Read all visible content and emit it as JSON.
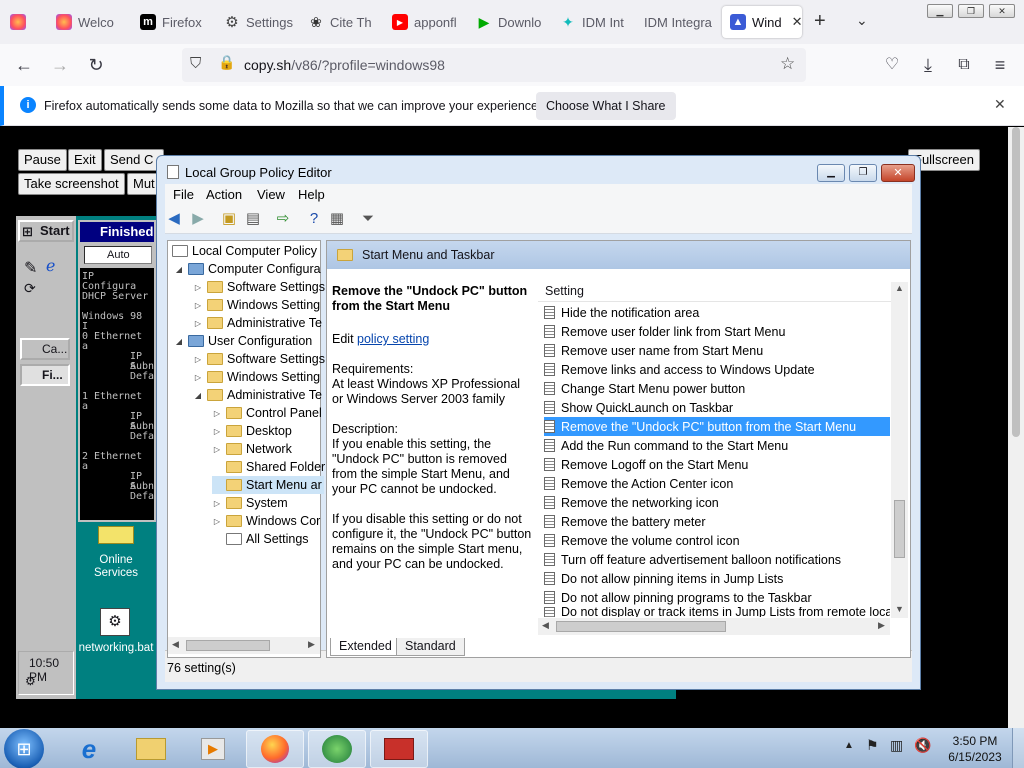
{
  "tabs": [
    {
      "label": "",
      "icon": "firefox-icon"
    },
    {
      "label": "Welco",
      "icon": "firefox-icon"
    },
    {
      "label": "Firefox I",
      "icon": "mdn-icon"
    },
    {
      "label": "Settings",
      "icon": "gear-icon"
    },
    {
      "label": "Cite Th",
      "icon": "cite-icon"
    },
    {
      "label": "apponfl",
      "icon": "youtube-icon"
    },
    {
      "label": "Downlo",
      "icon": "download-icon"
    },
    {
      "label": "IDM Int",
      "icon": "idm-icon"
    },
    {
      "label": "IDM Integrat",
      "icon": ""
    },
    {
      "label": "Wind",
      "icon": "v86-icon"
    }
  ],
  "url": {
    "host": "copy.sh",
    "path": "/v86/?profile=windows98"
  },
  "notification": {
    "text": "Firefox automatically sends some data to Mozilla so that we can improve your experience.",
    "button": "Choose What I Share"
  },
  "emulator": {
    "buttons": [
      "Pause",
      "Exit",
      "Send C",
      "Take screenshot",
      "Mut"
    ],
    "fullscreen": "Fullscreen"
  },
  "win98": {
    "start": "Start",
    "tasks": [
      "Ca...",
      "Fi..."
    ],
    "cmd_title": "Finished -",
    "cmd_dropdown": "Auto",
    "cmd_lines": [
      "IP Configura",
      "DHCP Server",
      "Windows 98 I",
      "0 Ethernet a",
      "IP A",
      "Subn",
      "Defa",
      "1 Ethernet a",
      "IP A",
      "Subn",
      "Defa",
      "2 Ethernet a",
      "IP A",
      "Subn",
      "Defa"
    ],
    "clock": "10:50 PM",
    "desktop_icons": [
      {
        "label": "Online Services"
      },
      {
        "label": "networking.bat"
      }
    ]
  },
  "gpe": {
    "title": "Local Group Policy Editor",
    "menu": [
      "File",
      "Action",
      "View",
      "Help"
    ],
    "tree": [
      {
        "label": "Local Computer Policy",
        "level": 0,
        "expander": ""
      },
      {
        "label": "Computer Configura",
        "level": 1,
        "expander": "down"
      },
      {
        "label": "Software Settings",
        "level": 2,
        "expander": "right"
      },
      {
        "label": "Windows Setting",
        "level": 2,
        "expander": "right"
      },
      {
        "label": "Administrative Te",
        "level": 2,
        "expander": "right"
      },
      {
        "label": "User Configuration",
        "level": 1,
        "expander": "down"
      },
      {
        "label": "Software Settings",
        "level": 2,
        "expander": "right"
      },
      {
        "label": "Windows Setting",
        "level": 2,
        "expander": "right"
      },
      {
        "label": "Administrative Te",
        "level": 2,
        "expander": "down"
      },
      {
        "label": "Control Panel",
        "level": 3,
        "expander": "right"
      },
      {
        "label": "Desktop",
        "level": 3,
        "expander": "right"
      },
      {
        "label": "Network",
        "level": 3,
        "expander": "right"
      },
      {
        "label": "Shared Folder",
        "level": 3,
        "expander": ""
      },
      {
        "label": "Start Menu ar",
        "level": 3,
        "expander": "",
        "selected": true
      },
      {
        "label": "System",
        "level": 3,
        "expander": "right"
      },
      {
        "label": "Windows Cor",
        "level": 3,
        "expander": "right"
      },
      {
        "label": "All Settings",
        "level": 3,
        "expander": ""
      }
    ],
    "header": "Start Menu and Taskbar",
    "detail": {
      "title": "Remove the \"Undock PC\" button from the Start Menu",
      "edit_prefix": "Edit",
      "edit_link": "policy setting",
      "requirements_label": "Requirements:",
      "requirements": "At least Windows XP Professional or Windows Server 2003 family",
      "description_label": "Description:",
      "description1": "If you enable this setting, the \"Undock PC\" button is removed from the simple Start Menu, and your PC cannot be undocked.",
      "description2": "If you disable this setting or do not configure it, the \"Undock PC\" button remains on the simple Start menu, and your PC can be undocked."
    },
    "column": "Setting",
    "settings": [
      "Hide the notification area",
      "Remove user folder link from Start Menu",
      "Remove user name from Start Menu",
      "Remove links and access to Windows Update",
      "Change Start Menu power button",
      "Show QuickLaunch on Taskbar",
      "Remove the \"Undock PC\" button from the Start Menu",
      "Add the Run command to the Start Menu",
      "Remove Logoff on the Start Menu",
      "Remove the Action Center icon",
      "Remove the networking icon",
      "Remove the battery meter",
      "Remove the volume control icon",
      "Turn off feature advertisement balloon notifications",
      "Do not allow pinning items in Jump Lists",
      "Do not allow pinning programs to the Taskbar",
      "Do not display or track items in Jump Lists from remote loca"
    ],
    "selected_index": 6,
    "tabs": [
      "Extended",
      "Standard"
    ],
    "status": "76 setting(s)"
  },
  "taskbar": {
    "time": "3:50 PM",
    "date": "6/15/2023"
  }
}
